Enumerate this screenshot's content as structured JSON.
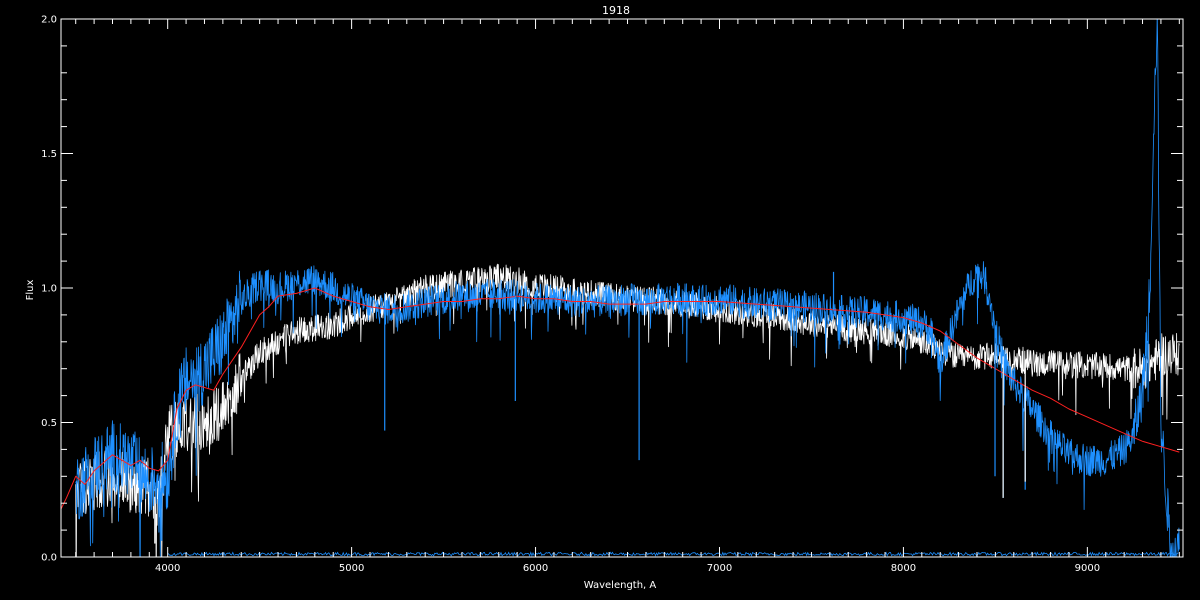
{
  "chart_data": {
    "type": "line",
    "title": "1918",
    "xlabel": "Wavelength, A",
    "ylabel": "Flux",
    "xlim": [
      3420,
      9520
    ],
    "ylim": [
      0,
      2.0
    ],
    "x_major_ticks": [
      4000,
      5000,
      6000,
      7000,
      8000,
      9000
    ],
    "x_tick_labels": [
      "4000",
      "5000",
      "6000",
      "7000",
      "8000",
      "9000"
    ],
    "y_major_ticks": [
      0,
      0.5,
      1.0,
      1.5,
      2.0
    ],
    "y_tick_labels": [
      "0.0",
      "0.5",
      "1.0",
      "1.5",
      "2.0"
    ],
    "grid": false,
    "background": "#000000",
    "axis_color": "#ffffff",
    "series": [
      {
        "color": "#ffffff",
        "style": "noisy-spectrum",
        "x": [
          3500,
          3600,
          3700,
          3800,
          3900,
          3950,
          4000,
          4100,
          4200,
          4300,
          4400,
          4500,
          4600,
          4700,
          4800,
          4900,
          5000,
          5100,
          5200,
          5300,
          5400,
          5500,
          5600,
          5700,
          5800,
          5900,
          6000,
          6100,
          6200,
          6300,
          6400,
          6500,
          6600,
          6700,
          6800,
          6900,
          7000,
          7100,
          7200,
          7300,
          7400,
          7500,
          7600,
          7700,
          7800,
          7900,
          8000,
          8100,
          8200,
          8300,
          8400,
          8500,
          8600,
          8700,
          8800,
          8900,
          9000,
          9100,
          9200,
          9300,
          9350,
          9400,
          9450,
          9500
        ],
        "y": [
          0.25,
          0.28,
          0.3,
          0.27,
          0.26,
          0.2,
          0.45,
          0.5,
          0.5,
          0.55,
          0.66,
          0.76,
          0.8,
          0.84,
          0.85,
          0.86,
          0.9,
          0.92,
          0.94,
          0.97,
          1.0,
          1.01,
          1.02,
          1.03,
          1.04,
          1.03,
          1.01,
          1.0,
          0.99,
          0.98,
          0.97,
          0.96,
          0.96,
          0.95,
          0.94,
          0.93,
          0.92,
          0.91,
          0.9,
          0.9,
          0.88,
          0.87,
          0.86,
          0.85,
          0.84,
          0.83,
          0.82,
          0.8,
          0.77,
          0.74,
          0.74,
          0.75,
          0.74,
          0.72,
          0.72,
          0.72,
          0.71,
          0.71,
          0.7,
          0.7,
          0.72,
          0.75,
          0.76,
          0.75
        ],
        "noise": 0.05
      },
      {
        "color": "#1e90ff",
        "style": "noisy-spectrum",
        "x": [
          3500,
          3600,
          3700,
          3800,
          3900,
          3950,
          4000,
          4050,
          4100,
          4200,
          4300,
          4400,
          4500,
          4600,
          4700,
          4800,
          4900,
          5000,
          5100,
          5200,
          5300,
          5400,
          5500,
          5600,
          5700,
          5800,
          5900,
          6000,
          6100,
          6200,
          6300,
          6400,
          6500,
          6600,
          6700,
          6800,
          6900,
          7000,
          7100,
          7200,
          7300,
          7400,
          7500,
          7600,
          7700,
          7800,
          7900,
          8000,
          8100,
          8150,
          8200,
          8250,
          8300,
          8350,
          8400,
          8450,
          8500,
          8550,
          8600,
          8650,
          8700,
          8800,
          8900,
          9000,
          9100,
          9200,
          9250,
          9300,
          9340,
          9360,
          9380,
          9400,
          9450,
          9500
        ],
        "y": [
          0.25,
          0.33,
          0.38,
          0.35,
          0.28,
          0.3,
          0.3,
          0.55,
          0.65,
          0.7,
          0.8,
          0.95,
          1.02,
          1.0,
          1.02,
          1.03,
          1.0,
          0.96,
          0.93,
          0.92,
          0.93,
          0.95,
          0.96,
          0.97,
          0.97,
          0.98,
          0.97,
          0.96,
          0.96,
          0.95,
          0.95,
          0.95,
          0.96,
          0.95,
          0.96,
          0.96,
          0.95,
          0.96,
          0.95,
          0.94,
          0.94,
          0.93,
          0.93,
          0.92,
          0.91,
          0.91,
          0.9,
          0.89,
          0.87,
          0.84,
          0.72,
          0.82,
          0.92,
          1.0,
          1.06,
          1.03,
          0.85,
          0.72,
          0.65,
          0.6,
          0.55,
          0.45,
          0.38,
          0.36,
          0.36,
          0.4,
          0.45,
          0.62,
          1.0,
          1.6,
          2.0,
          0.5,
          0.05,
          0.03
        ],
        "noise": 0.06
      },
      {
        "color": "#ff2020",
        "style": "smooth",
        "x": [
          3400,
          3450,
          3500,
          3550,
          3600,
          3650,
          3700,
          3750,
          3800,
          3850,
          3900,
          3950,
          4000,
          4050,
          4100,
          4150,
          4200,
          4250,
          4300,
          4400,
          4500,
          4550,
          4600,
          4700,
          4800,
          4900,
          5000,
          5100,
          5200,
          5300,
          5400,
          5500,
          5600,
          5700,
          5800,
          5900,
          6000,
          6100,
          6200,
          6300,
          6400,
          6500,
          6600,
          6700,
          6800,
          6900,
          7000,
          7200,
          7400,
          7600,
          7800,
          7900,
          8000,
          8100,
          8200,
          8300,
          8400,
          8500,
          8600,
          8700,
          8800,
          8900,
          9000,
          9100,
          9200,
          9300,
          9400,
          9500
        ],
        "y": [
          0.15,
          0.22,
          0.3,
          0.27,
          0.32,
          0.35,
          0.38,
          0.36,
          0.34,
          0.36,
          0.33,
          0.32,
          0.36,
          0.55,
          0.62,
          0.64,
          0.63,
          0.62,
          0.68,
          0.78,
          0.9,
          0.93,
          0.97,
          0.98,
          1.0,
          0.97,
          0.95,
          0.93,
          0.92,
          0.93,
          0.94,
          0.95,
          0.95,
          0.96,
          0.96,
          0.97,
          0.96,
          0.96,
          0.95,
          0.95,
          0.94,
          0.94,
          0.94,
          0.95,
          0.95,
          0.95,
          0.95,
          0.94,
          0.93,
          0.92,
          0.91,
          0.9,
          0.89,
          0.87,
          0.84,
          0.79,
          0.74,
          0.7,
          0.66,
          0.62,
          0.59,
          0.55,
          0.52,
          0.49,
          0.46,
          0.43,
          0.41,
          0.39
        ],
        "noise": 0.0
      }
    ],
    "absorption_dips": [
      {
        "series": 1,
        "x": 5180,
        "y": 0.47
      },
      {
        "series": 1,
        "x": 5890,
        "y": 0.58
      },
      {
        "series": 1,
        "x": 6563,
        "y": 0.36
      },
      {
        "series": 1,
        "x": 8498,
        "y": 0.3
      },
      {
        "series": 1,
        "x": 8542,
        "y": 0.22
      },
      {
        "series": 1,
        "x": 8662,
        "y": 0.25
      },
      {
        "series": 0,
        "x": 8542,
        "y": 0.22
      },
      {
        "series": 0,
        "x": 8662,
        "y": 0.28
      },
      {
        "series": 0,
        "x": 3930,
        "y": 0.05
      },
      {
        "series": 1,
        "x": 3968,
        "y": 0.06
      }
    ],
    "emission_spikes": [
      {
        "series": 1,
        "x": 7620,
        "y": 1.06
      }
    ]
  }
}
